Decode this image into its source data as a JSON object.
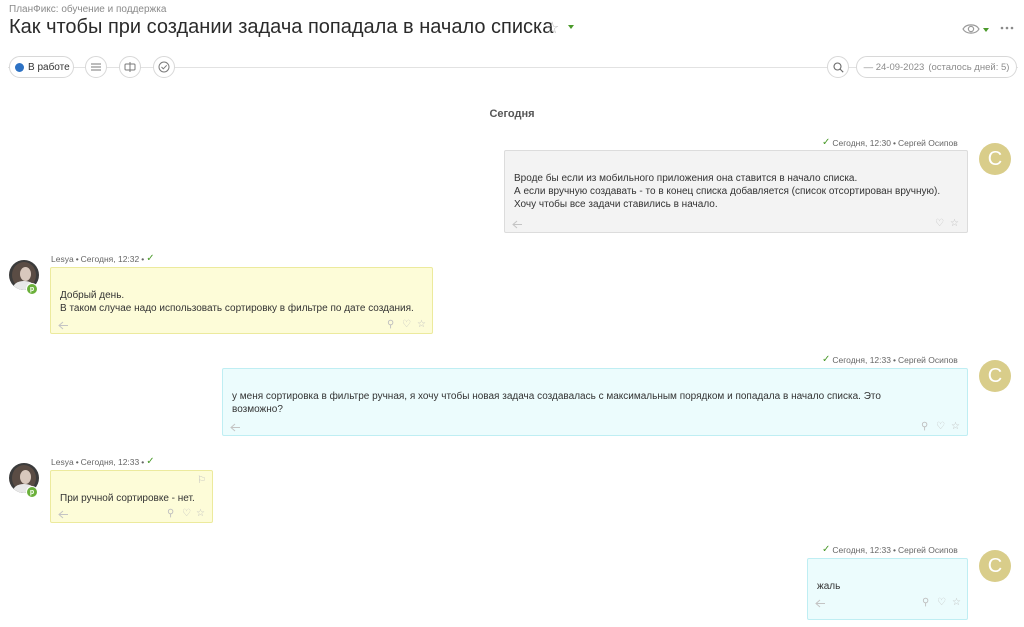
{
  "header": {
    "breadcrumb": "ПланФикс: обучение и поддержка",
    "title": "Как чтобы при создании задача попадала в начало списка",
    "star_icon": "star-outline-icon",
    "eye_icon": "eye-icon",
    "menu_icon": "more-dots-icon"
  },
  "toolbar": {
    "status_label": "В работе",
    "status_color": "#2d72c4",
    "buttons": [
      "list-icon",
      "comment-filter-icon",
      "check-circle-icon"
    ],
    "search_icon": "search-icon",
    "deadline": "— 24-09-2023",
    "remaining": "(осталось дней: 5)"
  },
  "feed": {
    "day_label": "Сегодня",
    "messages": [
      {
        "side": "right",
        "author": "Сергей Осипов",
        "time": "Сегодня, 12:30",
        "avatar_letter": "C",
        "style": "gray",
        "lines": [
          "Вроде бы если из мобильного приложения она ставится в начало списка.",
          "А если вручную создавать - то в конец списка добавляется (список отсортирован вручную).",
          "Хочу чтобы все задачи ставились в начало."
        ]
      },
      {
        "side": "left",
        "author": "Lesya",
        "time": "Сегодня, 12:32",
        "badge": "p",
        "style": "yellow",
        "lines": [
          "Добрый день.",
          "В таком случае надо использовать сортировку в фильтре по дате создания."
        ]
      },
      {
        "side": "right",
        "author": "Сергей Осипов",
        "time": "Сегодня, 12:33",
        "avatar_letter": "C",
        "style": "cyan",
        "lines": [
          "у меня сортировка в фильтре ручная, я хочу чтобы новая задача создавалась с максимальным порядком и попадала в начало списка. Это",
          "возможно?"
        ]
      },
      {
        "side": "left",
        "author": "Lesya",
        "time": "Сегодня, 12:33",
        "badge": "p",
        "style": "yellow",
        "lines": [
          "При ручной сортировке - нет."
        ]
      },
      {
        "side": "right",
        "author": "Сергей Осипов",
        "time": "Сегодня, 12:33",
        "avatar_letter": "C",
        "style": "cyan",
        "lines": [
          "жаль"
        ]
      }
    ]
  },
  "colors": {
    "accent_green": "#4a9a2a",
    "avatar_c": "#d9cd8a",
    "bubble_gray": "#f3f3f3",
    "bubble_yellow": "#fdfcd8",
    "bubble_cyan": "#ecfcfd"
  }
}
